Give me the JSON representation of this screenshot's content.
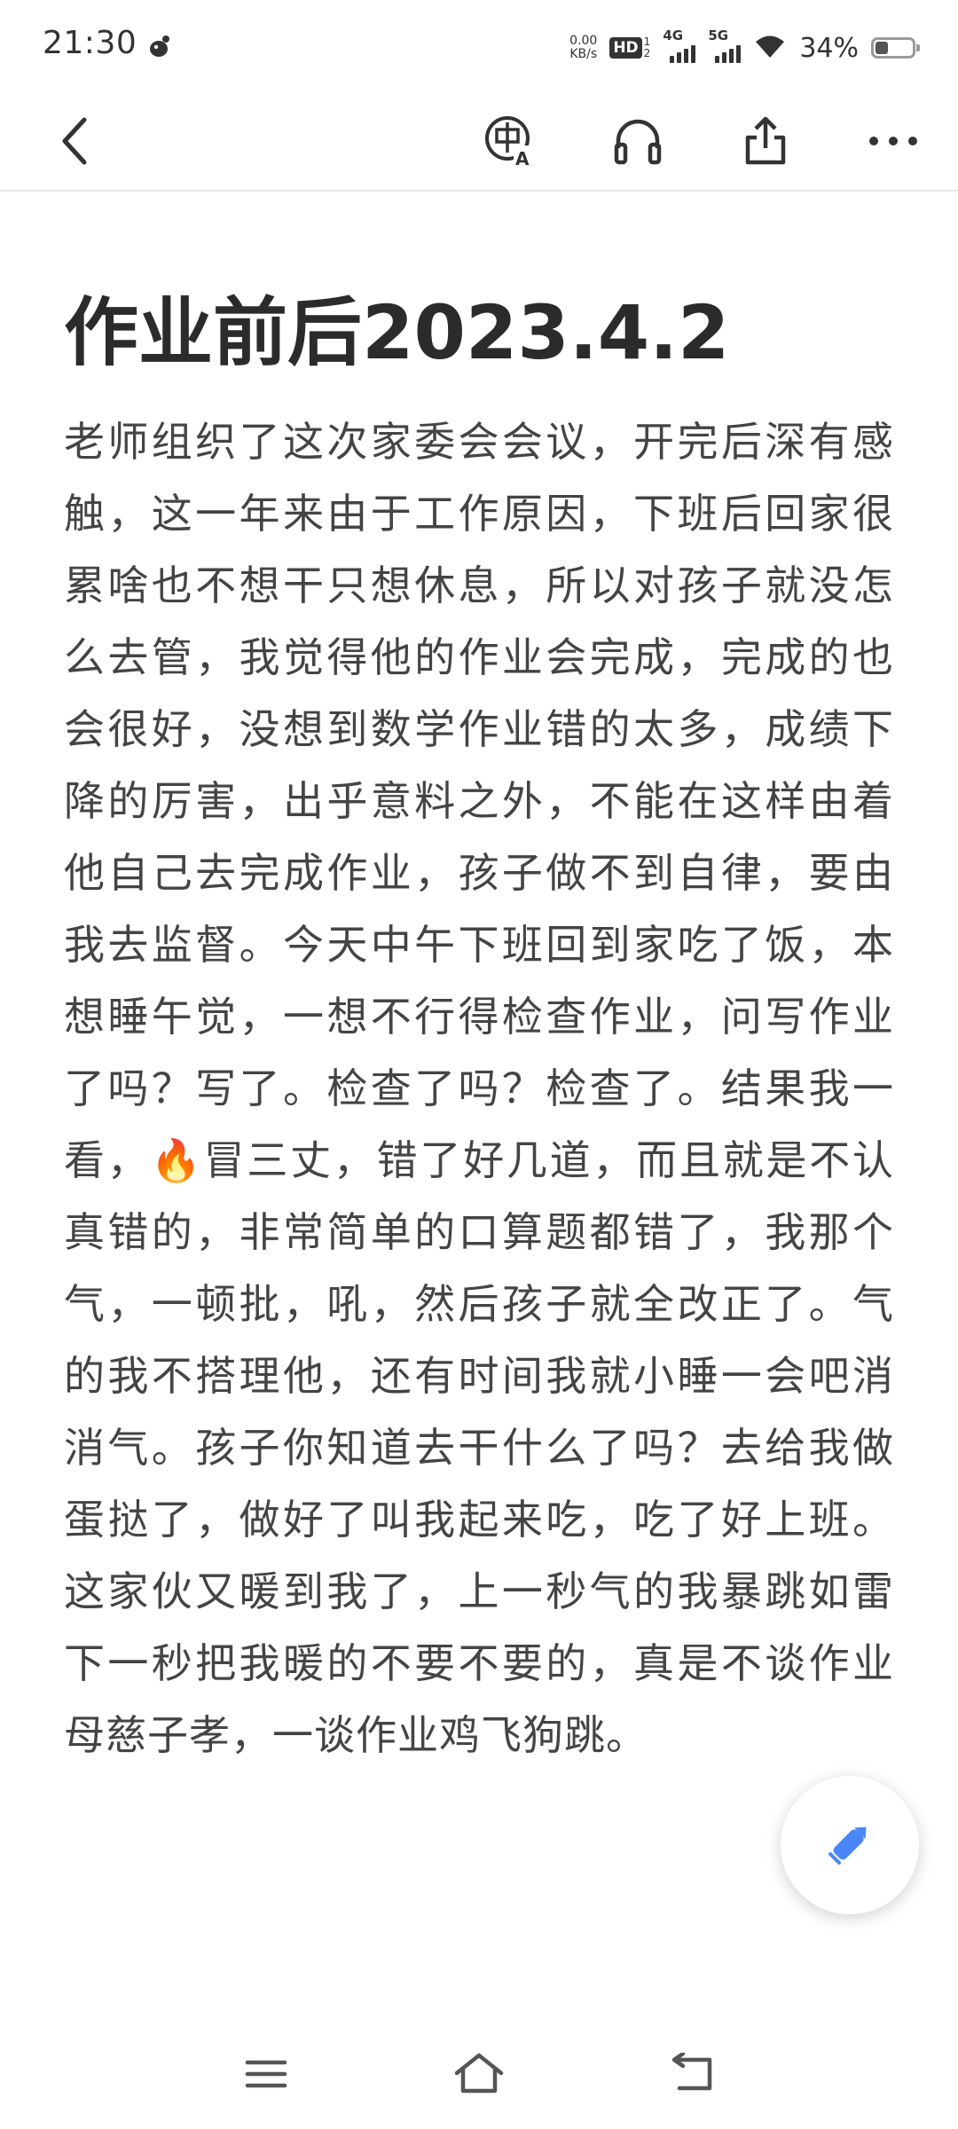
{
  "status_bar": {
    "time": "21:30",
    "net_speed_value": "0.00",
    "net_speed_unit": "KB/s",
    "hd_label": "HD",
    "hd_sub_top": "1",
    "hd_sub_bottom": "2",
    "signal_1_label": "4G",
    "signal_2_label": "5G",
    "battery_text": "34%",
    "battery_level": 0.34
  },
  "toolbar": {
    "back_icon": "chevron-left-icon",
    "translate_icon": "translate-icon",
    "listen_icon": "headphones-icon",
    "share_icon": "share-icon",
    "more_icon": "more-dots-icon"
  },
  "article": {
    "title": "作业前后2023.4.2",
    "body": "老师组织了这次家委会会议，开完后深有感触，这一年来由于工作原因，下班后回家很累啥也不想干只想休息，所以对孩子就没怎么去管，我觉得他的作业会完成，完成的也会很好，没想到数学作业错的太多，成绩下降的厉害，出乎意料之外，不能在这样由着他自己去完成作业，孩子做不到自律，要由我去监督。今天中午下班回到家吃了饭，本想睡午觉，一想不行得检查作业，问写作业了吗？写了。检查了吗？检查了。结果我一看，🔥冒三丈，错了好几道，而且就是不认真错的，非常简单的口算题都错了，我那个气，一顿批，吼，然后孩子就全改正了。气的我不搭理他，还有时间我就小睡一会吧消消气。孩子你知道去干什么了吗？去给我做蛋挞了，做好了叫我起来吃，吃了好上班。这家伙又暖到我了，上一秒气的我暴跳如雷下一秒把我暖的不要不要的，真是不谈作业母慈子孝，一谈作业鸡飞狗跳。"
  },
  "fab": {
    "icon": "pencil-edit-icon",
    "color": "#4a86f7"
  },
  "nav_bar": {
    "menu_icon": "menu-icon",
    "home_icon": "home-icon",
    "back_icon": "back-return-icon"
  }
}
